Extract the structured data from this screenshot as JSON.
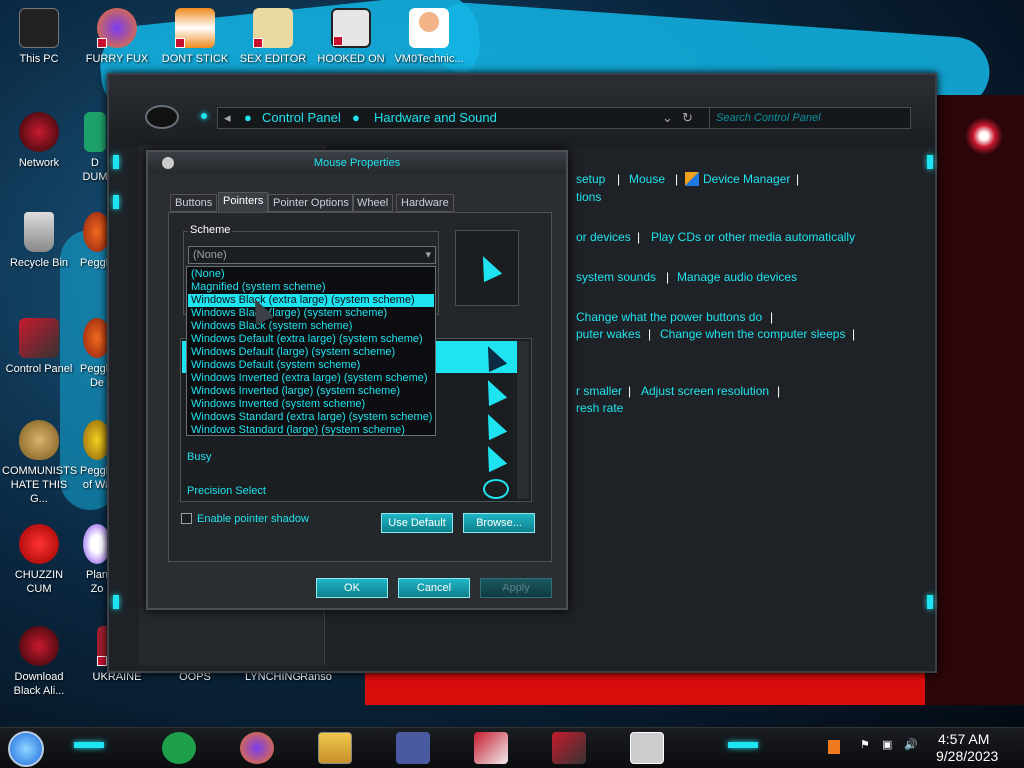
{
  "desktop": {
    "icons": [
      {
        "label": "This PC"
      },
      {
        "label": "FURRY FUX"
      },
      {
        "label": "DONT STICK"
      },
      {
        "label": "SEX EDITOR"
      },
      {
        "label": "HOOKED ON"
      },
      {
        "label": "VM0Technic..."
      },
      {
        "label": "Network"
      },
      {
        "label": "Recycle Bin"
      },
      {
        "label": "Control Panel"
      },
      {
        "label": "COMMUNISTS HATE THIS G..."
      },
      {
        "label": "CHUZZIN CUM"
      },
      {
        "label": "Download Black Ali..."
      },
      {
        "label": "UKRAINE"
      },
      {
        "label": "OOPS"
      },
      {
        "label": "LYNCHING"
      },
      {
        "label": "Ranso"
      },
      {
        "label": "D DUM"
      },
      {
        "label": "Peggle"
      },
      {
        "label": "Peggle De"
      },
      {
        "label": "Peggle of Wa"
      },
      {
        "label": "Plan Zo"
      }
    ]
  },
  "explorer": {
    "breadcrumb": [
      "Control Panel",
      "Hardware and Sound"
    ],
    "search_placeholder": "Search Control Panel",
    "links": {
      "setup": "setup",
      "mouse": "Mouse",
      "device_manager": "Device Manager",
      "tions": "tions",
      "or_devices": "or devices",
      "play_cds": "Play CDs or other media automatically",
      "system_sounds": "system sounds",
      "manage_audio": "Manage audio devices",
      "power_buttons": "Change what the power buttons do",
      "puter_wakes": "puter wakes",
      "computer_sleeps": "Change when the computer sleeps",
      "r_smaller": "r smaller",
      "adjust_res": "Adjust screen resolution",
      "resh_rate": "resh rate"
    }
  },
  "dialog": {
    "title": "Mouse Properties",
    "tabs": [
      "Buttons",
      "Pointers",
      "Pointer Options",
      "Wheel",
      "Hardware"
    ],
    "active_tab": "Pointers",
    "scheme_label": "Scheme",
    "scheme_value": "(None)",
    "scheme_options": [
      "(None)",
      "Magnified (system scheme)",
      "Windows Black (extra large) (system scheme)",
      "Windows Black (large) (system scheme)",
      "Windows Black (system scheme)",
      "Windows Default (extra large) (system scheme)",
      "Windows Default (large) (system scheme)",
      "Windows Default (system scheme)",
      "Windows Inverted (extra large) (system scheme)",
      "Windows Inverted (large) (system scheme)",
      "Windows Inverted (system scheme)",
      "Windows Standard (extra large) (system scheme)",
      "Windows Standard (large) (system scheme)"
    ],
    "highlighted_option_index": 2,
    "cursor_rows": [
      "Busy",
      "Precision Select"
    ],
    "enable_shadow_label": "Enable pointer shadow",
    "use_default_label": "Use Default",
    "browse_label": "Browse...",
    "ok_label": "OK",
    "cancel_label": "Cancel",
    "apply_label": "Apply"
  },
  "tray": {
    "time": "4:57 AM",
    "date": "9/28/2023"
  },
  "colors": {
    "accent": "#1ee3f0",
    "background": "#0b2a44",
    "panel": "#2a2d31"
  }
}
